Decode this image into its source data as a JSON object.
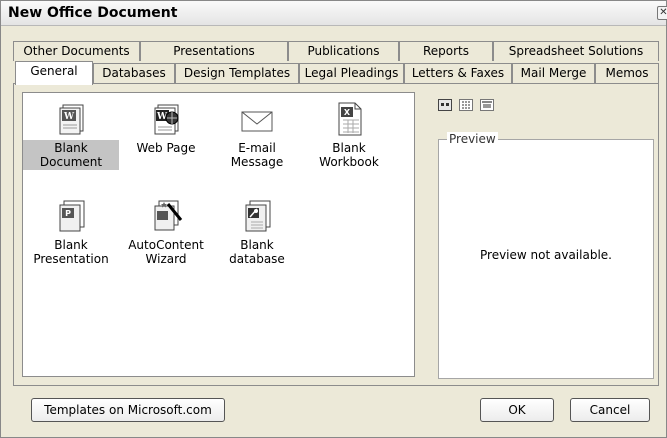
{
  "window": {
    "title": "New Office Document",
    "close_glyph": "✕"
  },
  "tabs_back": [
    "Other Documents",
    "Presentations",
    "Publications",
    "Reports",
    "Spreadsheet Solutions"
  ],
  "tabs_front": [
    "General",
    "Databases",
    "Design Templates",
    "Legal Pleadings",
    "Letters & Faxes",
    "Mail Merge",
    "Memos"
  ],
  "active_tab": "General",
  "items": [
    {
      "label": "Blank Document",
      "icon": "word-document-icon",
      "selected": true
    },
    {
      "label": "Web Page",
      "icon": "web-page-icon",
      "selected": false
    },
    {
      "label": "E-mail Message",
      "icon": "email-envelope-icon",
      "selected": false
    },
    {
      "label": "Blank Workbook",
      "icon": "excel-workbook-icon",
      "selected": false
    },
    {
      "label": "Blank\nPresentation",
      "icon": "powerpoint-presentation-icon",
      "selected": false
    },
    {
      "label": "AutoContent\nWizard",
      "icon": "autocontent-wizard-icon",
      "selected": false
    },
    {
      "label": "Blank database",
      "icon": "access-database-icon",
      "selected": false
    }
  ],
  "view_buttons": [
    "large-icons-view-icon",
    "list-view-icon",
    "details-view-icon"
  ],
  "preview": {
    "legend": "Preview",
    "message": "Preview not available."
  },
  "buttons": {
    "templates": "Templates on Microsoft.com",
    "ok": "OK",
    "cancel": "Cancel"
  }
}
